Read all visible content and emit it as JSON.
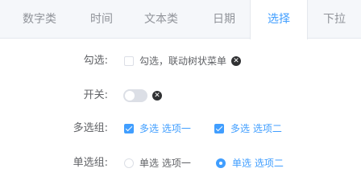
{
  "tabs": [
    {
      "label": "数字类",
      "active": false
    },
    {
      "label": "时间",
      "active": false
    },
    {
      "label": "文本类",
      "active": false
    },
    {
      "label": "日期",
      "active": false
    },
    {
      "label": "选择",
      "active": true
    },
    {
      "label": "下拉",
      "active": false
    }
  ],
  "form": {
    "checkbox_field": {
      "label": "勾选:",
      "option": "勾选，联动树状菜单",
      "checked": false
    },
    "switch_field": {
      "label": "开关:",
      "on": false
    },
    "checkbox_group": {
      "label": "多选组:",
      "options": [
        {
          "label": "多选 选项一",
          "checked": true
        },
        {
          "label": "多选 选项二",
          "checked": true
        }
      ]
    },
    "radio_group": {
      "label": "单选组:",
      "options": [
        {
          "label": "单选 选项一",
          "checked": false
        },
        {
          "label": "单选 选项二",
          "checked": true
        }
      ]
    }
  },
  "icons": {
    "clear": "close-circle-icon",
    "check": "checkmark-icon"
  },
  "colors": {
    "accent": "#409eff",
    "text": "#606266",
    "muted": "#909399",
    "border": "#dcdfe6",
    "tab_bar": "#f5f7fa"
  }
}
